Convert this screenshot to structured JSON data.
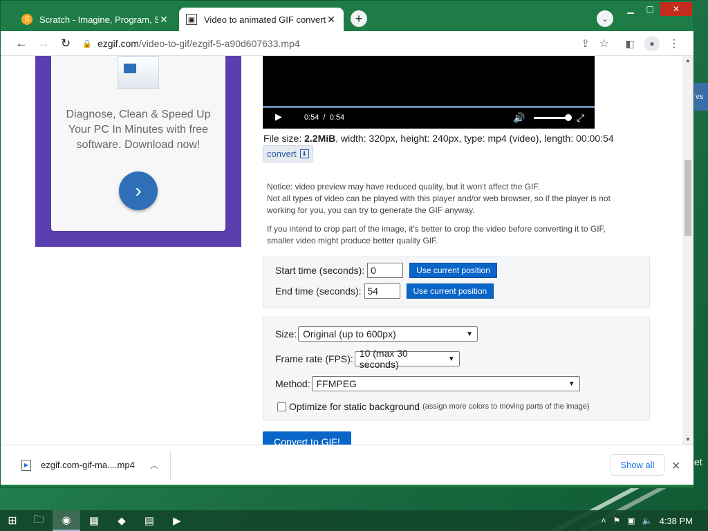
{
  "tabs": [
    {
      "title": "Scratch - Imagine, Program, Shar",
      "favicon": "scratch-cat-icon"
    },
    {
      "title": "Video to animated GIF converter",
      "favicon": "ezgif-icon"
    }
  ],
  "address_bar": {
    "domain": "ezgif.com",
    "path": "/video-to-gif/ezgif-5-a90d607633.mp4"
  },
  "ad": {
    "text": "Diagnose, Clean & Speed Up Your PC In Minutes with free software. Download now!"
  },
  "video": {
    "current_time": "0:54",
    "separator": "/",
    "duration": "0:54",
    "progress": 1.0,
    "volume": 0.9
  },
  "file_info": {
    "prefix": "File size: ",
    "size": "2.2MiB",
    "rest": ", width: 320px, height: 240px, type: mp4 (video), length: 00:00:54"
  },
  "convert_link": "convert",
  "notice": {
    "p1_line1": "Notice: video preview may have reduced quality, but it won't affect the GIF.",
    "p1_line2": "Not all types of video can be played with this player and/or web browser, so if the player is not working for you, you can try to generate the GIF anyway.",
    "p2": "If you intend to crop part of the image, it's better to crop the video before converting it to GIF, smaller video might produce better quality GIF."
  },
  "timing": {
    "start_label": "Start time (seconds):",
    "start_value": "0",
    "end_label": "End time (seconds):",
    "end_value": "54",
    "use_current_label": "Use current position"
  },
  "options": {
    "size_label": "Size:",
    "size_value": "Original (up to 600px)",
    "fps_label": "Frame rate (FPS):",
    "fps_value": "10 (max 30 seconds)",
    "method_label": "Method:",
    "method_value": "FFMPEG",
    "optimize_label": "Optimize for static background",
    "optimize_note": "(assign more colors to moving parts of the image)"
  },
  "convert_button": "Convert to GIF!",
  "downloads": {
    "file": "ezgif.com-gif-ma....mp4",
    "show_all": "Show all"
  },
  "taskbar": {
    "time": "4:38 PM"
  },
  "desktop": {
    "peek_text": "vs",
    "peek_text2": "et"
  },
  "colors": {
    "window_frame": "#1e7d47",
    "ad_bg": "#5b3fae",
    "button_blue": "#0a65c8",
    "link_blue": "#1a73e8"
  }
}
